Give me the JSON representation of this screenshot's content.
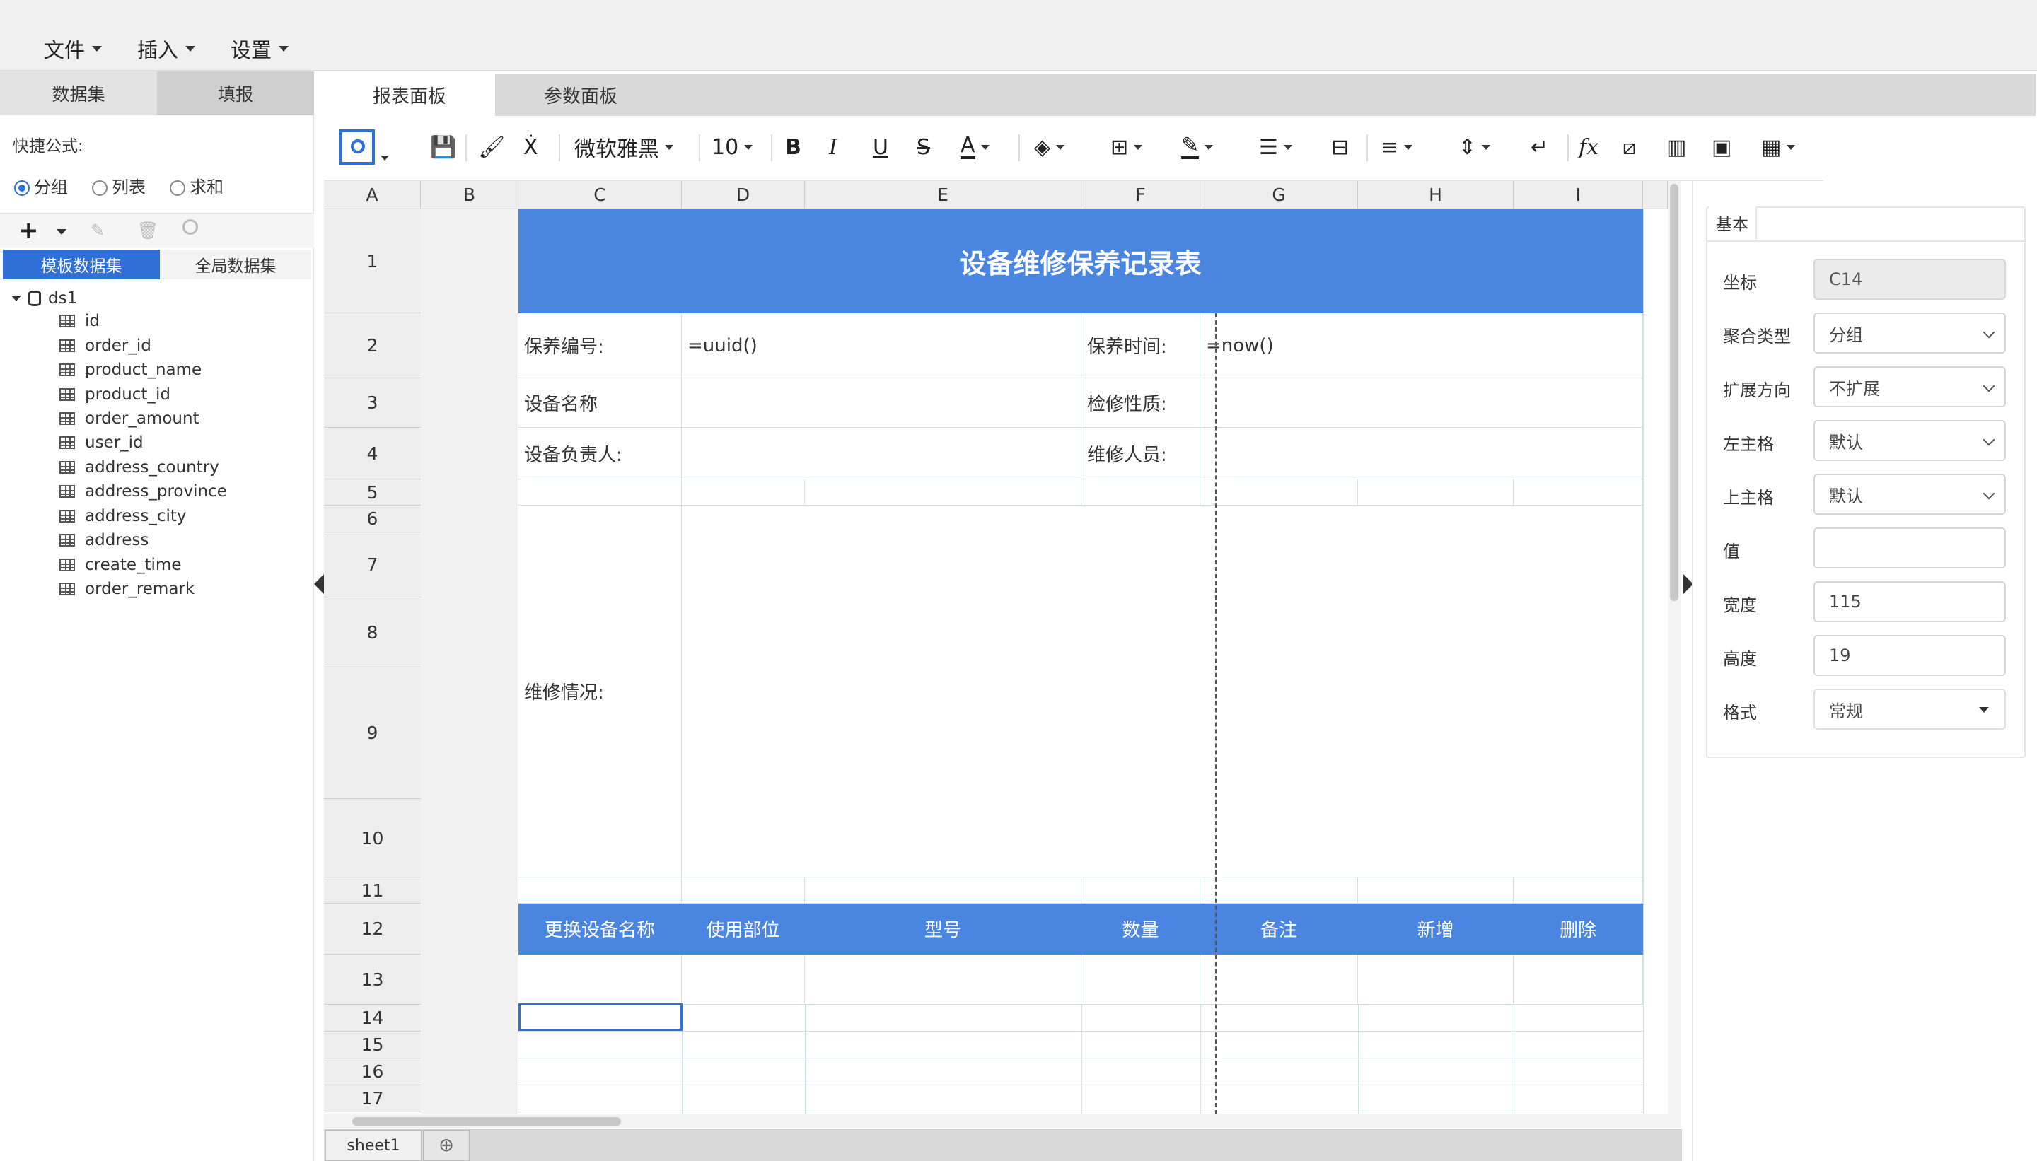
{
  "menu": {
    "file": "文件",
    "insert": "插入",
    "settings": "设置"
  },
  "left": {
    "tabs": [
      "数据集",
      "填报"
    ],
    "formula_label": "快捷公式:",
    "radios": [
      "分组",
      "列表",
      "求和"
    ],
    "subtabs": [
      "模板数据集",
      "全局数据集"
    ],
    "dataset": "ds1",
    "fields": [
      "id",
      "order_id",
      "product_name",
      "product_id",
      "order_amount",
      "user_id",
      "address_country",
      "address_province",
      "address_city",
      "address",
      "create_time",
      "order_remark"
    ]
  },
  "center": {
    "tabs": [
      "报表面板",
      "参数面板"
    ],
    "font": "微软雅黑",
    "font_size": "10",
    "columns": [
      "A",
      "B",
      "C",
      "D",
      "E",
      "F",
      "G",
      "H",
      "I"
    ],
    "rows": [
      "1",
      "2",
      "3",
      "4",
      "5",
      "6",
      "7",
      "8",
      "9",
      "10",
      "11",
      "12",
      "13",
      "14",
      "15",
      "16",
      "17"
    ],
    "title": "设备维修保养记录表",
    "labels": {
      "maint_no": "保养编号:",
      "uuid": "=uuid()",
      "maint_time": "保养时间:",
      "now": "=now()",
      "device_name": "设备名称",
      "inspect_type": "检修性质:",
      "device_owner": "设备负责人:",
      "repair_staff": "维修人员:",
      "repair_status": "维修情况:"
    },
    "table_headers": [
      "更换设备名称",
      "使用部位",
      "型号",
      "数量",
      "备注",
      "新增",
      "删除"
    ],
    "sheet_tab": "sheet1"
  },
  "right": {
    "tab": "基本",
    "props": [
      {
        "label": "坐标",
        "value": "C14"
      },
      {
        "label": "聚合类型",
        "value": "分组"
      },
      {
        "label": "扩展方向",
        "value": "不扩展"
      },
      {
        "label": "左主格",
        "value": "默认"
      },
      {
        "label": "上主格",
        "value": "默认"
      },
      {
        "label": "值",
        "value": ""
      },
      {
        "label": "宽度",
        "value": "115"
      },
      {
        "label": "高度",
        "value": "19"
      },
      {
        "label": "格式",
        "value": "常规"
      }
    ]
  },
  "colors": {
    "accent": "#4a86e0",
    "tab_active": "#2f6fd6"
  }
}
